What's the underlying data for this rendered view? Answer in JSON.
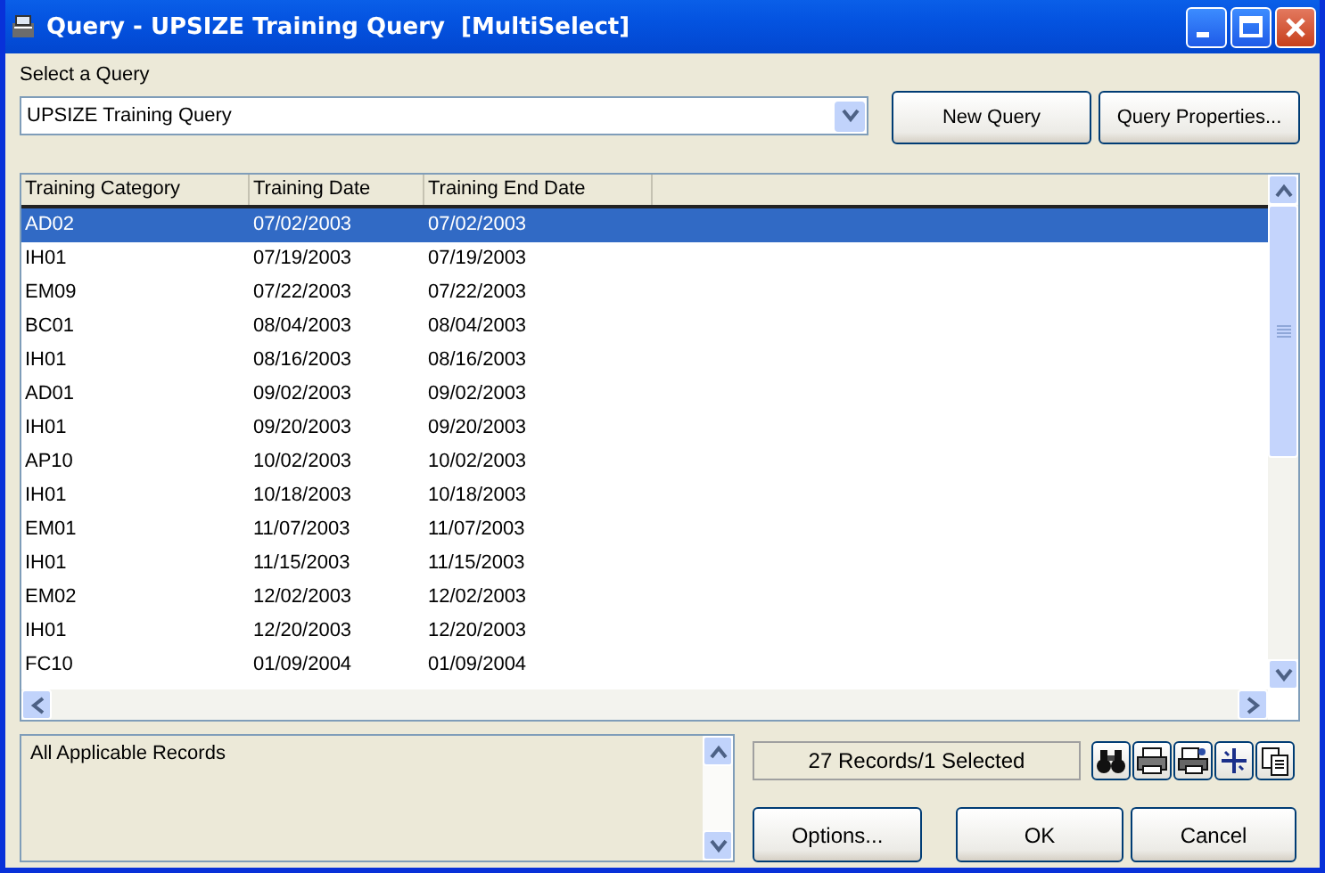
{
  "window": {
    "title": "Query - UPSIZE Training Query  [MultiSelect]"
  },
  "query_select": {
    "label": "Select a Query",
    "value": "UPSIZE Training Query"
  },
  "top_buttons": [
    "New Query",
    "Query Properties..."
  ],
  "table": {
    "columns": [
      "Training Category",
      "Training Date",
      "Training End Date"
    ],
    "rows": [
      {
        "cells": [
          "AD02",
          "07/02/2003",
          "07/02/2003"
        ],
        "selected": true
      },
      {
        "cells": [
          "IH01",
          "07/19/2003",
          "07/19/2003"
        ],
        "selected": false
      },
      {
        "cells": [
          "EM09",
          "07/22/2003",
          "07/22/2003"
        ],
        "selected": false
      },
      {
        "cells": [
          "BC01",
          "08/04/2003",
          "08/04/2003"
        ],
        "selected": false
      },
      {
        "cells": [
          "IH01",
          "08/16/2003",
          "08/16/2003"
        ],
        "selected": false
      },
      {
        "cells": [
          "AD01",
          "09/02/2003",
          "09/02/2003"
        ],
        "selected": false
      },
      {
        "cells": [
          "IH01",
          "09/20/2003",
          "09/20/2003"
        ],
        "selected": false
      },
      {
        "cells": [
          "AP10",
          "10/02/2003",
          "10/02/2003"
        ],
        "selected": false
      },
      {
        "cells": [
          "IH01",
          "10/18/2003",
          "10/18/2003"
        ],
        "selected": false
      },
      {
        "cells": [
          "EM01",
          "11/07/2003",
          "11/07/2003"
        ],
        "selected": false
      },
      {
        "cells": [
          "IH01",
          "11/15/2003",
          "11/15/2003"
        ],
        "selected": false
      },
      {
        "cells": [
          "EM02",
          "12/02/2003",
          "12/02/2003"
        ],
        "selected": false
      },
      {
        "cells": [
          "IH01",
          "12/20/2003",
          "12/20/2003"
        ],
        "selected": false
      },
      {
        "cells": [
          "FC10",
          "01/09/2004",
          "01/09/2004"
        ],
        "selected": false
      }
    ]
  },
  "criteria": {
    "text": "All Applicable Records"
  },
  "status": "27 Records/1 Selected",
  "tools": [
    {
      "kind": "binoculars"
    },
    {
      "kind": "printer"
    },
    {
      "kind": "print-setup"
    },
    {
      "kind": "crosshair"
    },
    {
      "kind": "copy"
    }
  ],
  "bottom_buttons": [
    "Options...",
    "OK",
    "Cancel"
  ]
}
